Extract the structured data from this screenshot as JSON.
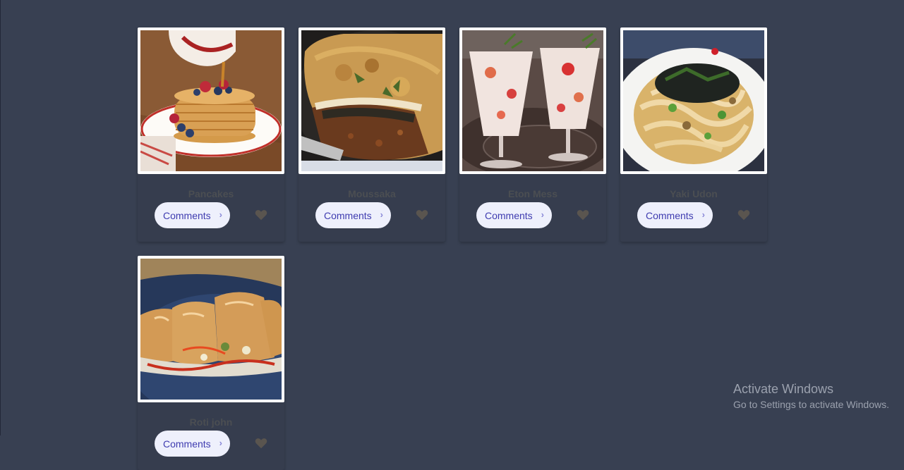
{
  "recipes": [
    {
      "title": "Pancakes",
      "image": "pancakes-photo",
      "comments_label": "Comments"
    },
    {
      "title": "Moussaka",
      "image": "moussaka-photo",
      "comments_label": "Comments"
    },
    {
      "title": "Eton Mess",
      "image": "eton-mess-photo",
      "comments_label": "Comments"
    },
    {
      "title": "Yaki Udon",
      "image": "yaki-udon-photo",
      "comments_label": "Comments"
    },
    {
      "title": "Roti john",
      "image": "roti-john-photo",
      "comments_label": "Comments"
    }
  ],
  "icons": {
    "chevron": "chevron-right-icon",
    "like": "heart-icon"
  },
  "colors": {
    "background": "#384052",
    "card": "#363d4e",
    "button_bg": "#eef0fc",
    "button_text": "#3f3cb0",
    "title_text": "#4b4e52",
    "heart": "#5a554f"
  },
  "watermark": {
    "title": "Activate Windows",
    "subtitle": "Go to Settings to activate Windows."
  }
}
